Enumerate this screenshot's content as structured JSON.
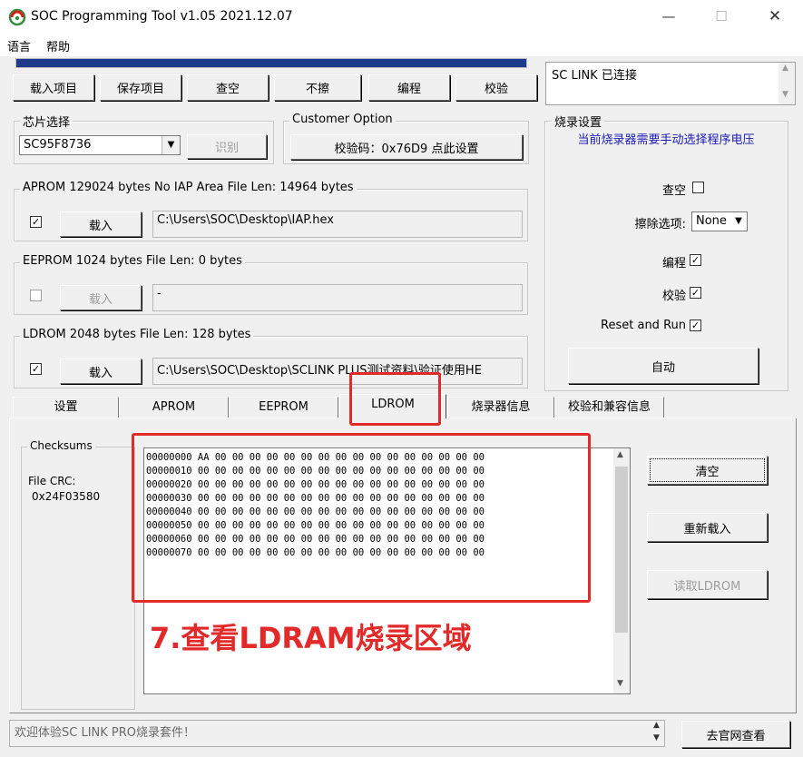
{
  "window": {
    "title": "SOC Programming Tool v1.05 2021.12.07",
    "minimize": "—",
    "maximize": "☐",
    "close": "✕"
  },
  "menu": {
    "language": "语言",
    "help": "帮助"
  },
  "progress": {
    "fraction": 1.0,
    "color": "#1e3a8a"
  },
  "toolbar": {
    "load_project": "载入项目",
    "save_project": "保存项目",
    "blank_check": "查空",
    "no_erase": "不擦",
    "program": "编程",
    "verify": "校验"
  },
  "link_status": "SC LINK 已连接",
  "chip_select": {
    "legend": "芯片选择",
    "value": "SC95F8736",
    "identify": "识别"
  },
  "customer_option": {
    "legend": "Customer Option",
    "button": "校验码：0x76D9  点此设置"
  },
  "aprom": {
    "legend": "APROM 129024 bytes  No IAP Area   File Len: 14964 bytes",
    "checked": "✓",
    "load": "载入",
    "path": "C:\\Users\\SOC\\Desktop\\IAP.hex"
  },
  "eeprom": {
    "legend": "EEPROM 1024 bytes    File Len: 0 bytes",
    "checked": "",
    "load": "载入",
    "path": "-"
  },
  "ldrom": {
    "legend": "LDROM 2048 bytes    File Len: 128 bytes",
    "checked": "✓",
    "load": "载入",
    "path": "C:\\Users\\SOC\\Desktop\\SCLINK PLUS测试资料\\验证使用HE"
  },
  "burn_settings": {
    "legend": "烧录设置",
    "notice": "当前烧录器需要手动选择程序电压",
    "blank_label": "查空",
    "blank_checked": "",
    "erase_label": "擦除选项:",
    "erase_value": "None",
    "program_label": "编程",
    "program_checked": "✓",
    "verify_label": "校验",
    "verify_checked": "✓",
    "reset_label": "Reset and Run",
    "reset_checked": "✓",
    "auto": "自动"
  },
  "tabs": {
    "settings": "设置",
    "aprom": "APROM",
    "eeprom": "EEPROM",
    "ldrom": "LDROM",
    "burner_info": "烧录器信息",
    "compat_info": "校验和兼容信息"
  },
  "checksums": {
    "legend": "Checksums",
    "crc_label": "File CRC:",
    "crc_value": "0x24F03580"
  },
  "hex_lines": [
    "00000000 AA 00 00 00 00 00 00 00 00 00 00 00 00 00 00 00 00",
    "00000010 00 00 00 00 00 00 00 00 00 00 00 00 00 00 00 00 00",
    "00000020 00 00 00 00 00 00 00 00 00 00 00 00 00 00 00 00 00",
    "00000030 00 00 00 00 00 00 00 00 00 00 00 00 00 00 00 00 00",
    "00000040 00 00 00 00 00 00 00 00 00 00 00 00 00 00 00 00 00",
    "00000050 00 00 00 00 00 00 00 00 00 00 00 00 00 00 00 00 00",
    "00000060 00 00 00 00 00 00 00 00 00 00 00 00 00 00 00 00 00",
    "00000070 00 00 00 00 00 00 00 00 00 00 00 00 00 00 00 00 00"
  ],
  "ldrom_actions": {
    "clear": "清空",
    "reload": "重新载入",
    "read": "读取LDROM"
  },
  "annotation": {
    "text": "7.查看LDRAM烧录区域",
    "color": "#e22a2a"
  },
  "status_bar": {
    "message": "欢迎体验SC LINK PRO烧录套件！",
    "website": "去官网查看"
  }
}
